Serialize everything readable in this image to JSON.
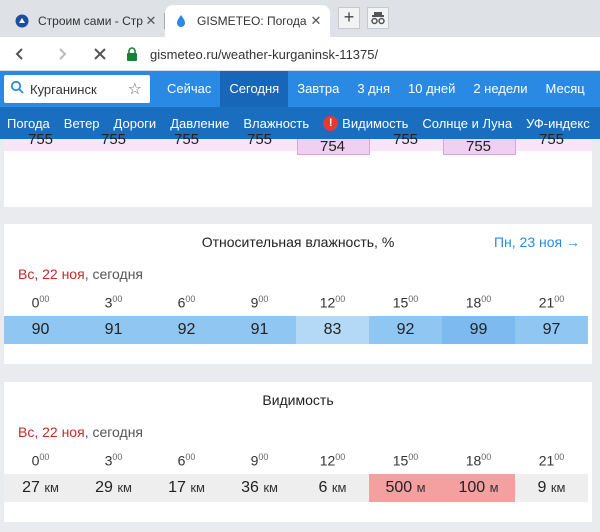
{
  "browser": {
    "tabs": [
      {
        "title": "Строим сами - Страни"
      },
      {
        "title": "GISMETEO: Погода в К"
      }
    ],
    "url": "gismeteo.ru/weather-kurganinsk-11375/"
  },
  "site": {
    "search_city": "Курганинск",
    "top_tabs": [
      "Сейчас",
      "Сегодня",
      "Завтра",
      "3 дня",
      "10 дней",
      "2 недели",
      "Месяц"
    ],
    "active_top_tab": "Сегодня",
    "sub_nav": [
      "Погода",
      "Ветер",
      "Дороги",
      "Давление",
      "Влажность",
      "Видимость",
      "Солнце и Луна",
      "УФ-индекс"
    ],
    "warning_item": "Видимость"
  },
  "pressure_partial": {
    "values": [
      "755",
      "755",
      "755",
      "755",
      "754",
      "755",
      "755",
      "755"
    ]
  },
  "humidity": {
    "title": "Относительная влажность, %",
    "next_link": "Пн, 23 ноя →",
    "date_highlight": "Вс, 22 ноя",
    "date_suffix": ", сегодня",
    "times": [
      {
        "h": "0",
        "m": "00"
      },
      {
        "h": "3",
        "m": "00"
      },
      {
        "h": "6",
        "m": "00"
      },
      {
        "h": "9",
        "m": "00"
      },
      {
        "h": "12",
        "m": "00"
      },
      {
        "h": "15",
        "m": "00"
      },
      {
        "h": "18",
        "m": "00"
      },
      {
        "h": "21",
        "m": "00"
      }
    ],
    "values": [
      "90",
      "91",
      "92",
      "91",
      "83",
      "92",
      "99",
      "97"
    ],
    "colors": [
      "#8fc6f2",
      "#8fc6f2",
      "#8fc6f2",
      "#8fc6f2",
      "#b3d9f7",
      "#8fc6f2",
      "#7cbaf0",
      "#8fc6f2"
    ]
  },
  "visibility": {
    "title": "Видимость",
    "date_highlight": "Вс, 22 ноя",
    "date_suffix": ", сегодня",
    "times": [
      {
        "h": "0",
        "m": "00"
      },
      {
        "h": "3",
        "m": "00"
      },
      {
        "h": "6",
        "m": "00"
      },
      {
        "h": "9",
        "m": "00"
      },
      {
        "h": "12",
        "m": "00"
      },
      {
        "h": "15",
        "m": "00"
      },
      {
        "h": "18",
        "m": "00"
      },
      {
        "h": "21",
        "m": "00"
      }
    ],
    "values": [
      {
        "v": "27",
        "u": "км"
      },
      {
        "v": "29",
        "u": "км"
      },
      {
        "v": "17",
        "u": "км"
      },
      {
        "v": "36",
        "u": "км"
      },
      {
        "v": "6",
        "u": "км"
      },
      {
        "v": "500",
        "u": "м"
      },
      {
        "v": "100",
        "u": "м"
      },
      {
        "v": "9",
        "u": "км"
      }
    ],
    "colors": [
      "#eeeeee",
      "#eeeeee",
      "#eeeeee",
      "#eeeeee",
      "#eeeeee",
      "#f4a0a0",
      "#f4a0a0",
      "#eeeeee"
    ]
  },
  "colors": {
    "header_blue": "#2a8ae3",
    "subnav_blue": "#1a6ebf",
    "active_tab": "#1766b7",
    "date_red": "#c62828"
  }
}
